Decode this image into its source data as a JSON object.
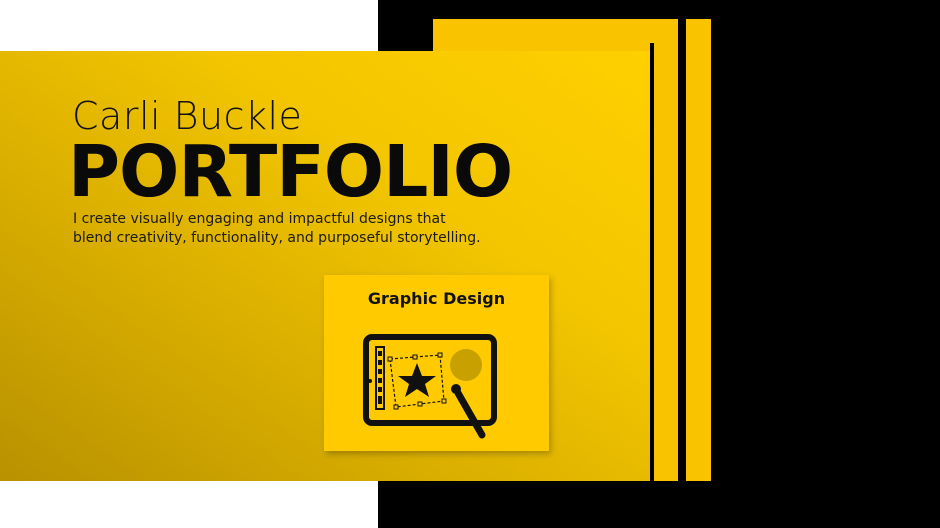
{
  "header": {
    "name": "Carli Buckle",
    "title": "PORTFOLIO",
    "tagline_line1": "I create visually engaging and impactful designs that",
    "tagline_line2": "blend creativity, functionality, and purposeful storytelling."
  },
  "card": {
    "label": "Graphic Design",
    "icon": "tablet-graphic-design-icon"
  },
  "colors": {
    "accent_yellow": "#F9C300",
    "black": "#000000",
    "white": "#FFFFFF"
  }
}
